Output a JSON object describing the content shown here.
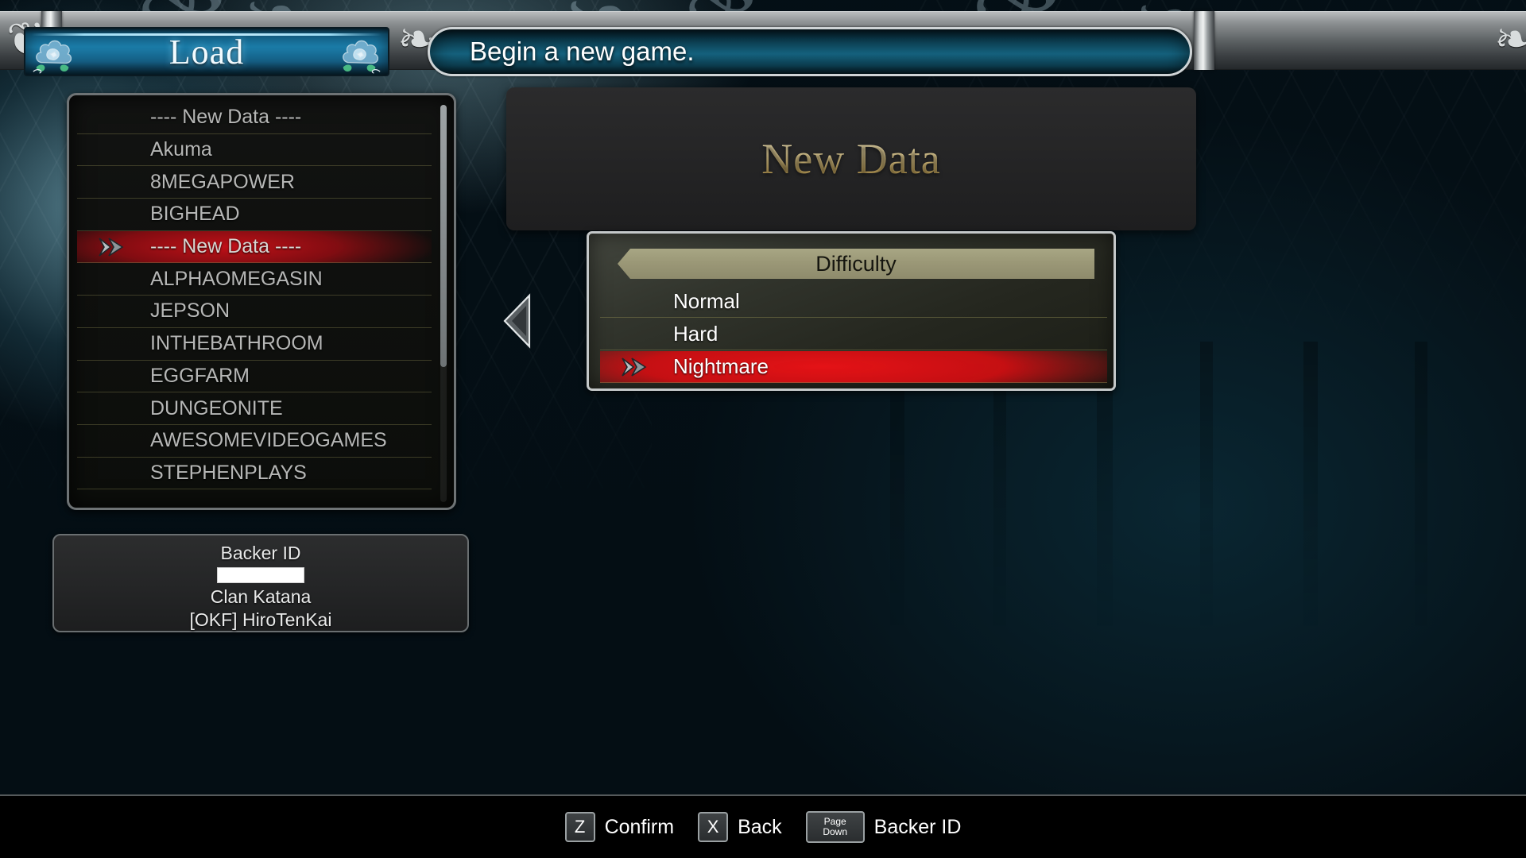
{
  "topbar": {
    "load_title": "Load",
    "message": "Begin a new game.",
    "rose_icon": "rose-ornament-icon",
    "scrollwork_icon": "scrollwork-ornament-icon"
  },
  "save_list": {
    "cursor_icon": "chevron-cursor-icon",
    "selected_index": 4,
    "items": [
      {
        "label": "---- New Data ----"
      },
      {
        "label": "Akuma"
      },
      {
        "label": "8MEGAPOWER"
      },
      {
        "label": "BIGHEAD"
      },
      {
        "label": "---- New Data ----"
      },
      {
        "label": "ALPHAOMEGASIN"
      },
      {
        "label": "JEPSON"
      },
      {
        "label": "INTHEBATHROOM"
      },
      {
        "label": "EGGFARM"
      },
      {
        "label": "DUNGEONITE"
      },
      {
        "label": "AWESOMEVIDEOGAMES"
      },
      {
        "label": "STEPHENPLAYS"
      }
    ]
  },
  "backer_panel": {
    "label": "Backer ID",
    "input_value": "",
    "clan": "Clan Katana",
    "name": "[OKF] HiroTenKai"
  },
  "detail_panel": {
    "title": "New Data",
    "page_left_icon": "page-left-arrow-icon"
  },
  "difficulty": {
    "header": "Difficulty",
    "cursor_icon": "chevron-cursor-icon",
    "selected_index": 2,
    "options": [
      {
        "label": "Normal"
      },
      {
        "label": "Hard"
      },
      {
        "label": "Nightmare"
      }
    ]
  },
  "footer": {
    "hints": [
      {
        "key": "Z",
        "key_sub": "",
        "label": "Confirm"
      },
      {
        "key": "X",
        "key_sub": "",
        "label": "Back"
      },
      {
        "key": "Page",
        "key_sub": "Down",
        "label": "Backer ID"
      }
    ]
  },
  "colors": {
    "selection_red": "#cd0e12",
    "difficulty_header_olive": "#9b9877",
    "gold_title": "#e3cf96",
    "banner_blue": "#1b7ca8"
  }
}
